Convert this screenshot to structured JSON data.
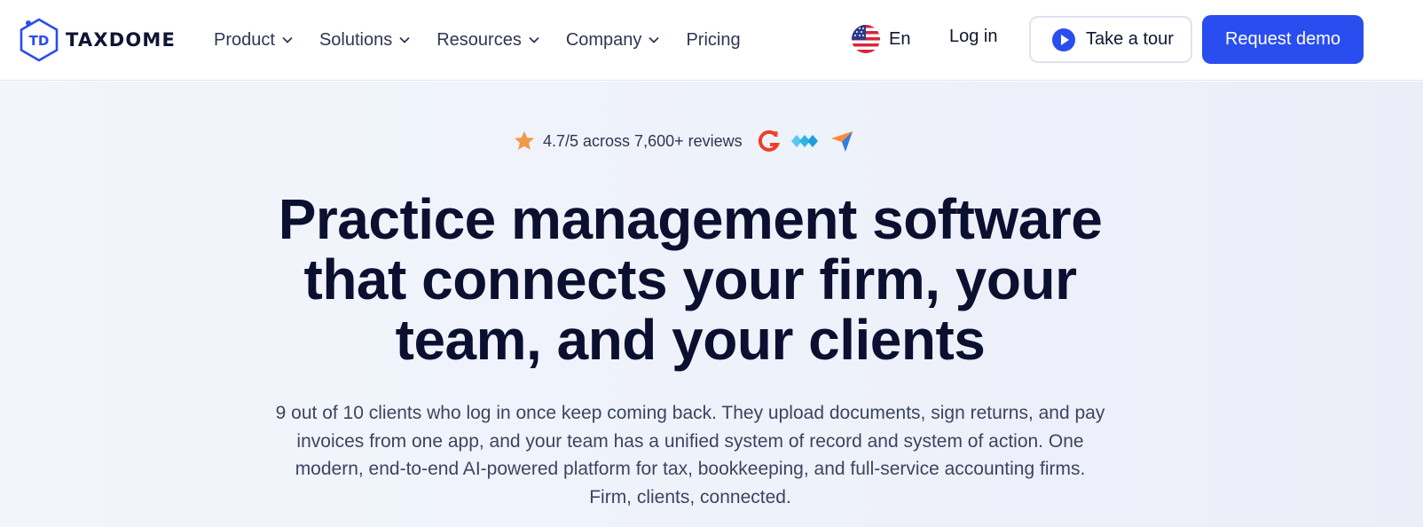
{
  "brand": {
    "logo_initials": "TD",
    "name": "TAXDOME",
    "color": "#2a4df0"
  },
  "nav": {
    "items": [
      {
        "label": "Product",
        "has_dropdown": true
      },
      {
        "label": "Solutions",
        "has_dropdown": true
      },
      {
        "label": "Resources",
        "has_dropdown": true
      },
      {
        "label": "Company",
        "has_dropdown": true
      },
      {
        "label": "Pricing",
        "has_dropdown": false
      }
    ]
  },
  "header_actions": {
    "language": {
      "label": "En",
      "icon": "us-flag-icon"
    },
    "login_label": "Log in",
    "tour_label": "Take a tour",
    "tour_icon": "play-icon",
    "demo_label": "Request demo"
  },
  "hero": {
    "rating_text": "4.7/5 across 7,600+ reviews",
    "rating_icon": "star-icon",
    "review_badges": [
      "g2-icon",
      "capterra-arrows-icon",
      "getapp-paper-plane-icon"
    ],
    "headline_lines": [
      "Practice management software",
      "that connects your firm, your",
      "team, and your clients"
    ],
    "subtext_lines": [
      "9 out of 10 clients who log in once keep coming back. They upload documents, sign returns, and pay",
      "invoices from one app, and your team has a unified system of record and system of action. One",
      "modern, end-to-end AI-powered platform for tax, bookkeeping, and full-service accounting firms.",
      "Firm, clients, connected."
    ]
  },
  "colors": {
    "primary": "#2a4df0",
    "headline": "#0b1030",
    "star": "#f09a4a"
  }
}
